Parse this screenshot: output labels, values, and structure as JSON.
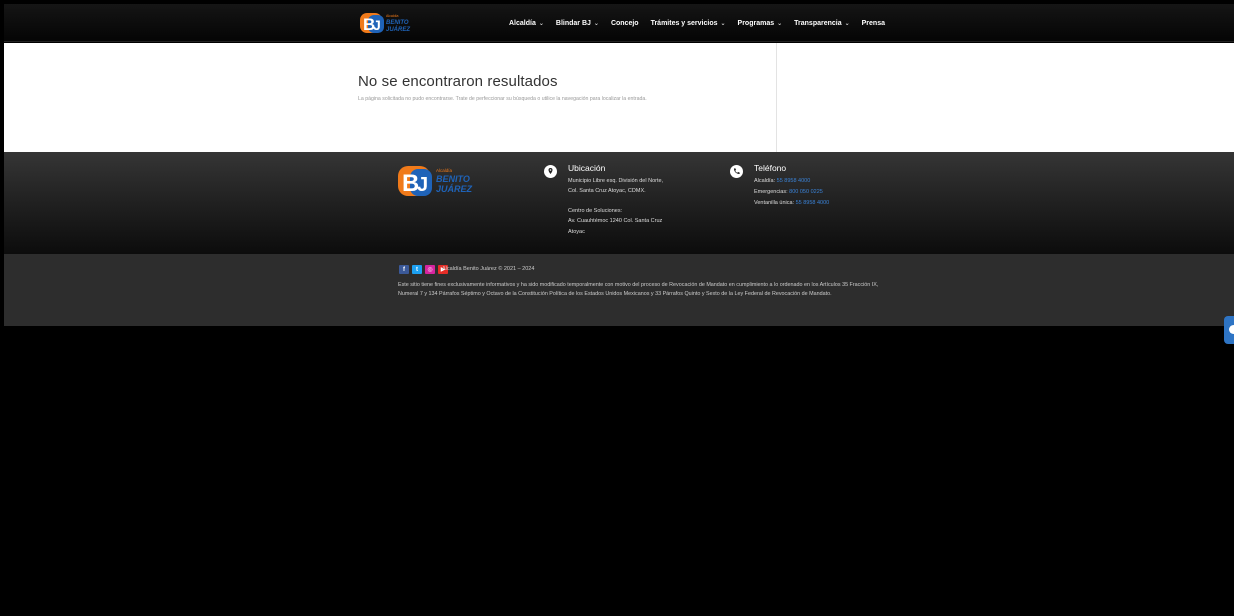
{
  "header": {
    "logo": {
      "small": "Alcaldía",
      "line1": "BENITO",
      "line2": "JUÁREZ"
    },
    "nav": [
      {
        "label": "Alcaldía",
        "dropdown": true
      },
      {
        "label": "Blindar BJ",
        "dropdown": true
      },
      {
        "label": "Concejo",
        "dropdown": false
      },
      {
        "label": "Trámites y servicios",
        "dropdown": true
      },
      {
        "label": "Programas",
        "dropdown": true
      },
      {
        "label": "Transparencia",
        "dropdown": true
      },
      {
        "label": "Prensa",
        "dropdown": false
      }
    ]
  },
  "main": {
    "title": "No se encontraron resultados",
    "text": "La página solicitada no pudo encontrarse. Trate de perfeccionar su búsqueda o utilice la navegación para localizar la entrada."
  },
  "footer": {
    "logo": {
      "small": "Alcaldía",
      "line1": "BENITO",
      "line2": "JUÁREZ"
    },
    "location": {
      "heading": "Ubicación",
      "line1": "Municipio Libre esq. División del Norte,",
      "line2": "Col. Santa Cruz Atoyac, CDMX.",
      "line3": "Centro de Soluciones:",
      "line4": "Av. Cuauhtémoc 1240 Col. Santa Cruz",
      "line5": "Atoyac"
    },
    "phone": {
      "heading": "Teléfono",
      "alcaldia_label": "Alcaldía:",
      "alcaldia_number": "55 8958 4000",
      "emergencias_label": "Emergencias:",
      "emergencias_number": "800 050 0225",
      "ventanilla_label": "Ventanilla única:",
      "ventanilla_number": "55 8958 4000"
    }
  },
  "bottom": {
    "social": [
      "facebook-icon",
      "twitter-icon",
      "instagram-icon",
      "youtube-icon"
    ],
    "copyright": "Alcaldía Benito Juárez © 2021 – 2024",
    "disclaimer": "Este sitio tiene fines exclusivamente informativos y ha sido modificado temporalmente con motivo del proceso de Revocación de Mandato en cumplimiento a lo ordenado en los Artículos 35 Fracción IX, Numeral 7 y 134 Párrafos Séptimo y Octavo de la Constitución Política de los Estados Unidos Mexicanos y 33 Párrafos Quinto y Sexto de la Ley Federal de Revocación de Mandato."
  },
  "colors": {
    "accent": "#3a82d6",
    "logo_orange": "#f07a1a",
    "logo_blue": "#1f63b8"
  }
}
